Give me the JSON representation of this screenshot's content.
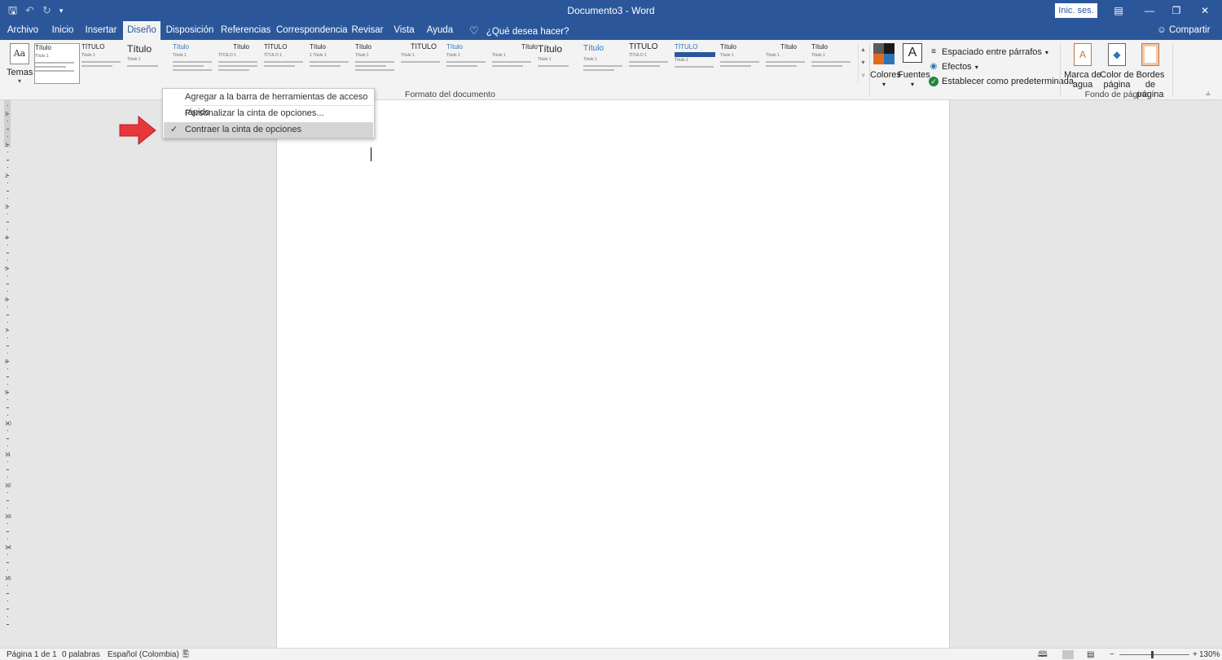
{
  "titlebar": {
    "title": "Documento3 - Word",
    "signin_label": "Inic. ses.",
    "save_icon": "save-icon",
    "undo_icon": "undo-icon",
    "redo_icon": "redo-icon",
    "customize_icon": "customize-qat-icon"
  },
  "tabs": [
    "Archivo",
    "Inicio",
    "Insertar",
    "Diseño",
    "Disposición",
    "Referencias",
    "Correspondencia",
    "Revisar",
    "Vista",
    "Ayuda"
  ],
  "active_tab": "Diseño",
  "tell_me": "¿Qué desea hacer?",
  "share": "Compartir",
  "ribbon": {
    "temas": "Temas",
    "styles": [
      {
        "title": "Título",
        "heading": "Título 1"
      },
      {
        "title": "TÍTULO",
        "heading": "Título 1"
      },
      {
        "title": "Título",
        "heading": "Título 1"
      },
      {
        "title": "Título",
        "heading": "Título 1"
      },
      {
        "title": "Título",
        "heading": "TÍTULO 1"
      },
      {
        "title": "TÍTULO",
        "heading": "TÍTULO 1"
      },
      {
        "title": "Título",
        "heading": "1 Título 1"
      },
      {
        "title": "Título",
        "heading": "Título 1"
      },
      {
        "title": "TÍTULO",
        "heading": "Título 1"
      },
      {
        "title": "Título",
        "heading": "Título 1"
      },
      {
        "title": "Título",
        "heading": "Título 1"
      },
      {
        "title": "Título",
        "heading": "Título 1"
      },
      {
        "title": "Título",
        "heading": "Título 1"
      },
      {
        "title": "TÍTULO",
        "heading": "TÍTULO 1"
      },
      {
        "title": "TÍTULO",
        "heading": "Título 1"
      },
      {
        "title": "Título",
        "heading": "Título 1"
      },
      {
        "title": "Título",
        "heading": "Título 1"
      },
      {
        "title": "Título",
        "heading": "Título 1"
      }
    ],
    "formato_label": "Formato del documento",
    "colores": "Colores",
    "fuentes": "Fuentes",
    "espaciado": "Espaciado entre párrafos",
    "efectos": "Efectos",
    "predeterminada": "Establecer como predeterminada",
    "marca_agua": "Marca de agua",
    "color_pagina": "Color de página",
    "bordes_pagina": "Bordes de página",
    "fondo_label": "Fondo de página",
    "theme_colors": [
      "#5b5b5b",
      "#1a1a1a",
      "#e06b1f",
      "#2e74b5"
    ]
  },
  "context_menu": {
    "items": [
      {
        "label": "Agregar a la barra de herramientas de acceso rápido",
        "checked": false
      },
      {
        "label": "Personalizar la cinta de opciones...",
        "checked": false
      },
      {
        "label": "Contraer la cinta de opciones",
        "checked": true
      }
    ],
    "check_mark": "✓"
  },
  "status": {
    "page": "Página 1 de 1",
    "words": "0 palabras",
    "language": "Español (Colombia)",
    "zoom": "130%",
    "zoom_minus": "−",
    "zoom_plus": "+"
  },
  "ruler_numbers": [
    "1",
    "1",
    "2",
    "3",
    "4",
    "5",
    "6",
    "7",
    "8",
    "9",
    "10",
    "11",
    "12",
    "13",
    "14",
    "15"
  ],
  "annotation_arrow_color": "#e8373a",
  "accent": "#2b579a"
}
